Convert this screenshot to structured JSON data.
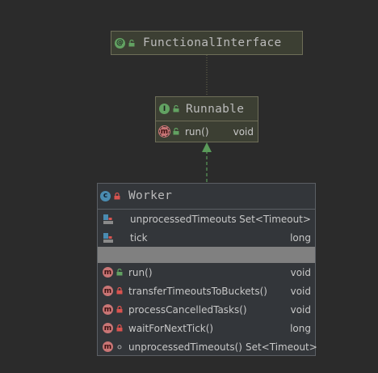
{
  "functional_interface": {
    "title": "FunctionalInterface",
    "icon": "annotation-icon"
  },
  "runnable": {
    "title": "Runnable",
    "icon": "interface-icon",
    "methods": [
      {
        "name": "run()",
        "type": "void",
        "icon": "abstract-method-icon"
      }
    ]
  },
  "worker": {
    "title": "Worker",
    "icon": "class-icon",
    "fields": [
      {
        "name": "unprocessedTimeouts",
        "type": "Set<Timeout>"
      },
      {
        "name": "tick",
        "type": "long"
      }
    ],
    "methods": [
      {
        "name": "run()",
        "type": "void",
        "visibility": "public"
      },
      {
        "name": "transferTimeoutsToBuckets()",
        "type": "void",
        "visibility": "private"
      },
      {
        "name": "processCancelledTasks()",
        "type": "void",
        "visibility": "private"
      },
      {
        "name": "waitForNextTick()",
        "type": "long",
        "visibility": "private"
      },
      {
        "name": "unprocessedTimeouts()",
        "type": "Set<Timeout>",
        "visibility": "package"
      }
    ]
  },
  "colors": {
    "background": "#2b2b2b",
    "interface_box": "#3c3f33",
    "class_box": "#33363a",
    "implements_arrow": "#5a9a5a",
    "annotation_link": "#6b6b4f"
  }
}
